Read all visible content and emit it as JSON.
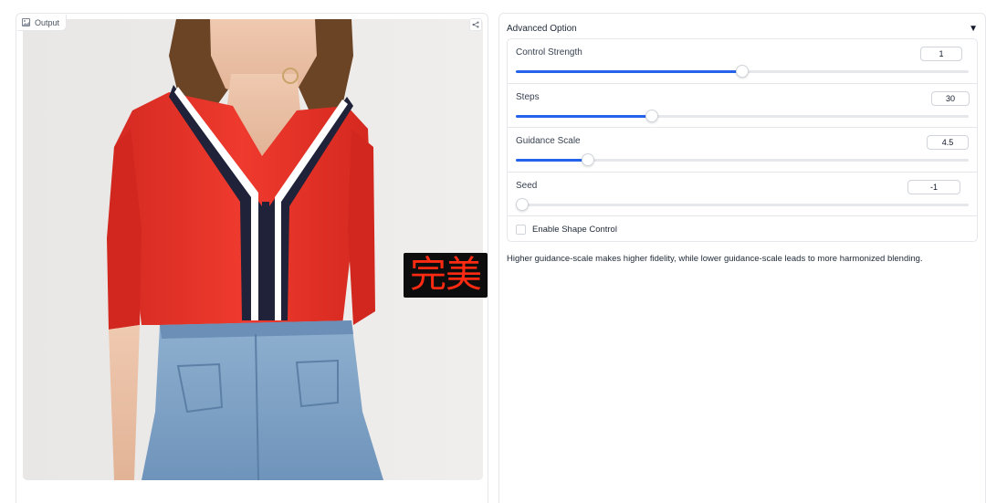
{
  "output": {
    "label": "Output",
    "icon": "image-icon",
    "share_icon": "share-icon",
    "stamp_text": "完美"
  },
  "advanced": {
    "title": "Advanced Option",
    "caret": "▼",
    "sliders": [
      {
        "label": "Control Strength",
        "value": "1",
        "fraction": 0.5
      },
      {
        "label": "Steps",
        "value": "30",
        "fraction": 0.3
      },
      {
        "label": "Guidance Scale",
        "value": "4.5",
        "fraction": 0.16
      },
      {
        "label": "Seed",
        "value": "-1",
        "fraction": 0.0
      }
    ],
    "checkbox": {
      "label": "Enable Shape Control",
      "checked": false
    }
  },
  "note": "Higher guidance-scale makes higher fidelity, while lower guidance-scale leads to more harmonized blending.",
  "colors": {
    "accent": "#2563eb",
    "border": "#e5e7eb",
    "stamp_bg": "#0d0d0d",
    "stamp_text": "#ff2a12"
  }
}
